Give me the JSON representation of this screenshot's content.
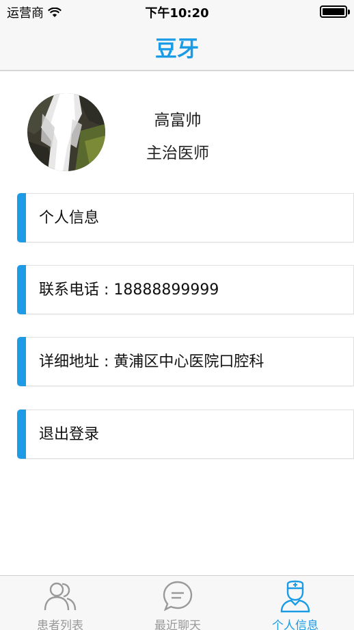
{
  "status_bar": {
    "carrier": "运营商",
    "time": "下午10:20"
  },
  "nav": {
    "title": "豆牙"
  },
  "profile": {
    "name": "高富帅",
    "role": "主治医师"
  },
  "cards": [
    {
      "label": "个人信息"
    },
    {
      "label": "联系电话 : 18888899999"
    },
    {
      "label": "详细地址 : 黄浦区中心医院口腔科"
    },
    {
      "label": "退出登录"
    }
  ],
  "tabs": [
    {
      "label": "患者列表",
      "icon": "users-icon",
      "active": false
    },
    {
      "label": "最近聊天",
      "icon": "chat-bubble-icon",
      "active": false
    },
    {
      "label": "个人信息",
      "icon": "doctor-icon",
      "active": true
    }
  ],
  "colors": {
    "accent": "#1a9be6",
    "inactive": "#999999",
    "card_bar": "#1f9be6"
  }
}
